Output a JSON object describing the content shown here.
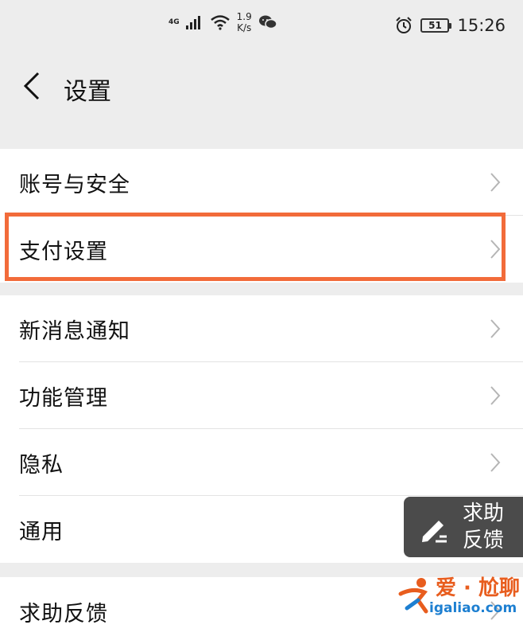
{
  "status_bar": {
    "network": "4G",
    "speed_value": "1.9",
    "speed_unit": "K/s",
    "battery": "51",
    "time": "15:26",
    "icons": [
      "signal-icon",
      "wifi-icon",
      "wechat-icon",
      "alarm-icon",
      "battery-icon"
    ]
  },
  "header": {
    "title": "设置",
    "back_icon": "chevron-left-icon"
  },
  "groups": [
    {
      "items": [
        {
          "label": "账号与安全"
        },
        {
          "label": "支付设置",
          "highlighted": true
        }
      ]
    },
    {
      "items": [
        {
          "label": "新消息通知"
        },
        {
          "label": "功能管理"
        },
        {
          "label": "隐私"
        },
        {
          "label": "通用"
        }
      ]
    },
    {
      "items": [
        {
          "label": "求助反馈"
        }
      ]
    }
  ],
  "floating_help": {
    "line1": "求助",
    "line2": "反馈",
    "icon": "edit-pen-icon"
  },
  "watermark": {
    "top": "爱 · 尬聊",
    "bottom": "igaliao.com"
  },
  "colors": {
    "background": "#ededed",
    "highlight": "#f26b3a",
    "float_bg": "#4b4b4b",
    "watermark_orange": "#e85d1e",
    "watermark_blue": "#1d7fd1"
  }
}
